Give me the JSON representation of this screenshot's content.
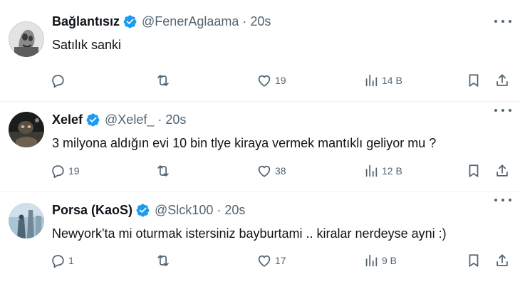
{
  "tweets": [
    {
      "name": "Bağlantısız",
      "handle": "@FenerAglaama",
      "separator": "·",
      "time": "20s",
      "text": "Satılık sanki",
      "replies": "",
      "retweets": "",
      "likes": "19",
      "views": "14 B"
    },
    {
      "name": "Xelef",
      "handle": "@Xelef_",
      "separator": "·",
      "time": "20s",
      "text": "3 milyona aldığın evi 10 bin tlye kiraya vermek mantıklı geliyor  mu ?",
      "replies": "19",
      "retweets": "",
      "likes": "38",
      "views": "12 B"
    },
    {
      "name": "Porsa (KaoS)",
      "handle": "@Slck100",
      "separator": "·",
      "time": "20s",
      "text": "Newyork'ta mi oturmak istersiniz bayburtami .. kiralar nerdeyse ayni :)",
      "replies": "1",
      "retweets": "",
      "likes": "17",
      "views": "9 B"
    }
  ],
  "icons": {
    "verified": "verified-badge-icon",
    "reply": "reply-icon",
    "retweet": "retweet-icon",
    "like": "heart-icon",
    "views": "views-chart-icon",
    "bookmark": "bookmark-icon",
    "share": "share-icon",
    "more": "more-options-icon"
  },
  "colors": {
    "verified": "#1d9bf0",
    "text": "#0f1419",
    "muted": "#536471",
    "divider": "#eff3f4"
  }
}
